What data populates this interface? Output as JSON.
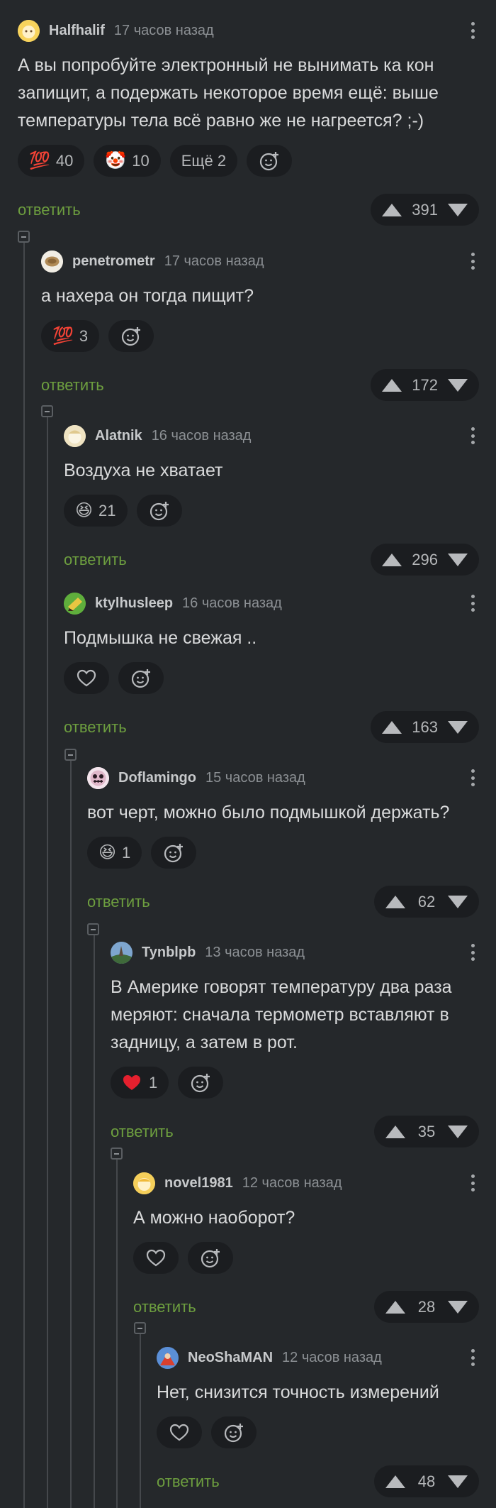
{
  "comments": [
    {
      "author": "Halfhalif",
      "time": "17 часов назад",
      "text": "А вы попробуйте электронный не вынимать ка кон запищит, а подержать некоторое время ещё: выше температуры тела всё равно же не нагреется? ;-)",
      "reactions": [
        {
          "emoji": "💯",
          "count": "40"
        },
        {
          "emoji": "🤡",
          "count": "10"
        }
      ],
      "more": "Ещё 2",
      "reply": "ответить",
      "score": "391"
    },
    {
      "author": "penetrometr",
      "time": "17 часов назад",
      "text": "а нахера он тогда пищит?",
      "reactions": [
        {
          "emoji": "💯",
          "count": "3"
        }
      ],
      "reply": "ответить",
      "score": "172"
    },
    {
      "author": "Alatnik",
      "time": "16 часов назад",
      "text": "Воздуха не хватает",
      "reactions": [
        {
          "emoji": "😆",
          "count": "21"
        }
      ],
      "reply": "ответить",
      "score": "296"
    },
    {
      "author": "ktylhusleep",
      "time": "16 часов назад",
      "text": "Подмышка не свежая ..",
      "reply": "ответить",
      "score": "163"
    },
    {
      "author": "Doflamingo",
      "time": "15 часов назад",
      "text": "вот черт, можно было подмышкой держать?",
      "reactions": [
        {
          "emoji": "😆",
          "count": "1"
        }
      ],
      "reply": "ответить",
      "score": "62"
    },
    {
      "author": "Tynblpb",
      "time": "13 часов назад",
      "text": "В Америке говорят температуру два раза меряют: сначала термометр вставляют в задницу, а затем в рот.",
      "reactions": [
        {
          "emoji": "❤️",
          "count": "1"
        }
      ],
      "reply": "ответить",
      "score": "35"
    },
    {
      "author": "novel1981",
      "time": "12 часов назад",
      "text": "А можно наоборот?",
      "reply": "ответить",
      "score": "28"
    },
    {
      "author": "NeoShaMAN",
      "time": "12 часов назад",
      "text": "Нет, снизится точность измерений",
      "reply": "ответить",
      "score": "48"
    }
  ],
  "icons": {
    "menu": "more-vertical-icon",
    "add_reaction": "smiley-plus-icon",
    "like": "heart-outline-icon",
    "upvote": "triangle-up-icon",
    "downvote": "triangle-down-icon",
    "collapse": "minus-square-icon"
  },
  "colors": {
    "background": "#25282b",
    "reply_link": "#6d9e3f",
    "pill": "#1b1d20"
  }
}
